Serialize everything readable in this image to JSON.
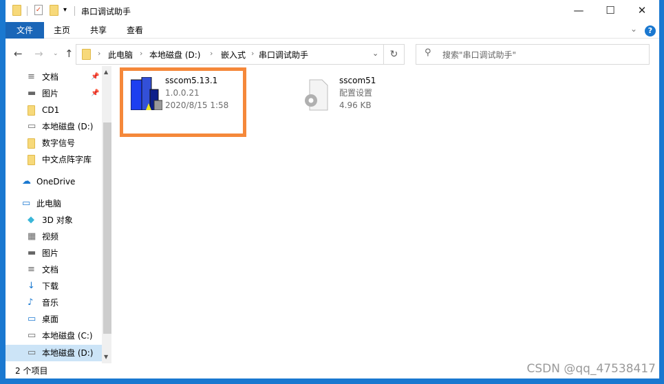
{
  "window": {
    "title": "串口调试助手",
    "minimize": "—",
    "maximize": "☐",
    "close": "✕"
  },
  "ribbon": {
    "tabs": [
      "文件",
      "主页",
      "共享",
      "查看"
    ],
    "collapse": "⌄",
    "help": "?"
  },
  "address": {
    "crumbs": [
      "此电脑",
      "本地磁盘 (D:)",
      "嵌入式",
      "串口调试助手"
    ],
    "search_placeholder": "搜索\"串口调试助手\""
  },
  "sidebar": {
    "items": [
      {
        "label": "文档",
        "icon": "document-icon",
        "pinned": true
      },
      {
        "label": "图片",
        "icon": "picture-icon",
        "pinned": true
      },
      {
        "label": "CD1",
        "icon": "folder-icon"
      },
      {
        "label": "本地磁盘 (D:)",
        "icon": "drive-icon"
      },
      {
        "label": "数字信号",
        "icon": "folder-icon"
      },
      {
        "label": "中文点阵字库",
        "icon": "folder-icon"
      },
      {
        "label": "OneDrive",
        "icon": "cloud-icon"
      },
      {
        "label": "此电脑",
        "icon": "computer-icon"
      },
      {
        "label": "3D 对象",
        "icon": "cube-icon"
      },
      {
        "label": "视频",
        "icon": "video-icon"
      },
      {
        "label": "图片",
        "icon": "picture-icon"
      },
      {
        "label": "文档",
        "icon": "document-icon"
      },
      {
        "label": "下载",
        "icon": "download-icon"
      },
      {
        "label": "音乐",
        "icon": "music-icon"
      },
      {
        "label": "桌面",
        "icon": "desktop-icon"
      },
      {
        "label": "本地磁盘 (C:)",
        "icon": "drive-icon"
      },
      {
        "label": "本地磁盘 (D:)",
        "icon": "drive-icon",
        "selected": true
      }
    ]
  },
  "files": [
    {
      "name": "sscom5.13.1",
      "line2": "1.0.0.21",
      "line3": "2020/8/15 1:58"
    },
    {
      "name": "sscom51",
      "line2": "配置设置",
      "line3": "4.96 KB"
    }
  ],
  "status": {
    "count": "2 个项目"
  },
  "watermark": "CSDN @qq_47538417",
  "colors": {
    "accent": "#1a66b8",
    "highlight": "#f5883a"
  }
}
